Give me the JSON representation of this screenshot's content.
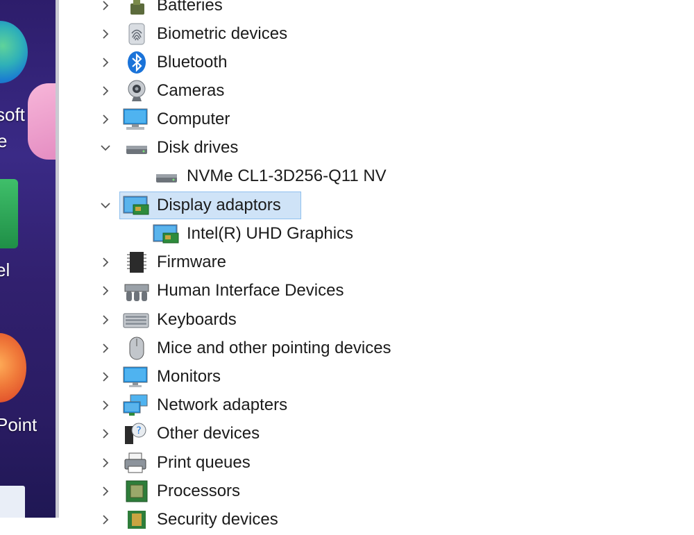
{
  "desktop": {
    "labels": [
      "soft",
      "e",
      "el",
      "Point"
    ]
  },
  "device_tree": {
    "items": [
      {
        "label": "Batteries",
        "expanded": false,
        "icon": "battery-icon"
      },
      {
        "label": "Biometric devices",
        "expanded": false,
        "icon": "fingerprint-icon"
      },
      {
        "label": "Bluetooth",
        "expanded": false,
        "icon": "bluetooth-icon"
      },
      {
        "label": "Cameras",
        "expanded": false,
        "icon": "camera-icon"
      },
      {
        "label": "Computer",
        "expanded": false,
        "icon": "computer-icon"
      },
      {
        "label": "Disk drives",
        "expanded": true,
        "icon": "disk-drive-icon"
      },
      {
        "label": "NVMe CL1-3D256-Q11 NV",
        "child": true,
        "icon": "disk-drive-icon"
      },
      {
        "label": "Display adaptors",
        "expanded": true,
        "selected": true,
        "icon": "display-adapter-icon"
      },
      {
        "label": "Intel(R) UHD Graphics",
        "child": true,
        "icon": "display-adapter-icon"
      },
      {
        "label": "Firmware",
        "expanded": false,
        "icon": "firmware-chip-icon"
      },
      {
        "label": "Human Interface Devices",
        "expanded": false,
        "icon": "hid-icon"
      },
      {
        "label": "Keyboards",
        "expanded": false,
        "icon": "keyboard-icon"
      },
      {
        "label": "Mice and other pointing devices",
        "expanded": false,
        "icon": "mouse-icon"
      },
      {
        "label": "Monitors",
        "expanded": false,
        "icon": "monitor-icon"
      },
      {
        "label": "Network adapters",
        "expanded": false,
        "icon": "network-adapter-icon"
      },
      {
        "label": "Other devices",
        "expanded": false,
        "icon": "unknown-device-icon"
      },
      {
        "label": "Print queues",
        "expanded": false,
        "icon": "printer-icon"
      },
      {
        "label": "Processors",
        "expanded": false,
        "icon": "processor-icon"
      },
      {
        "label": "Security devices",
        "expanded": false,
        "icon": "security-device-icon"
      }
    ]
  }
}
